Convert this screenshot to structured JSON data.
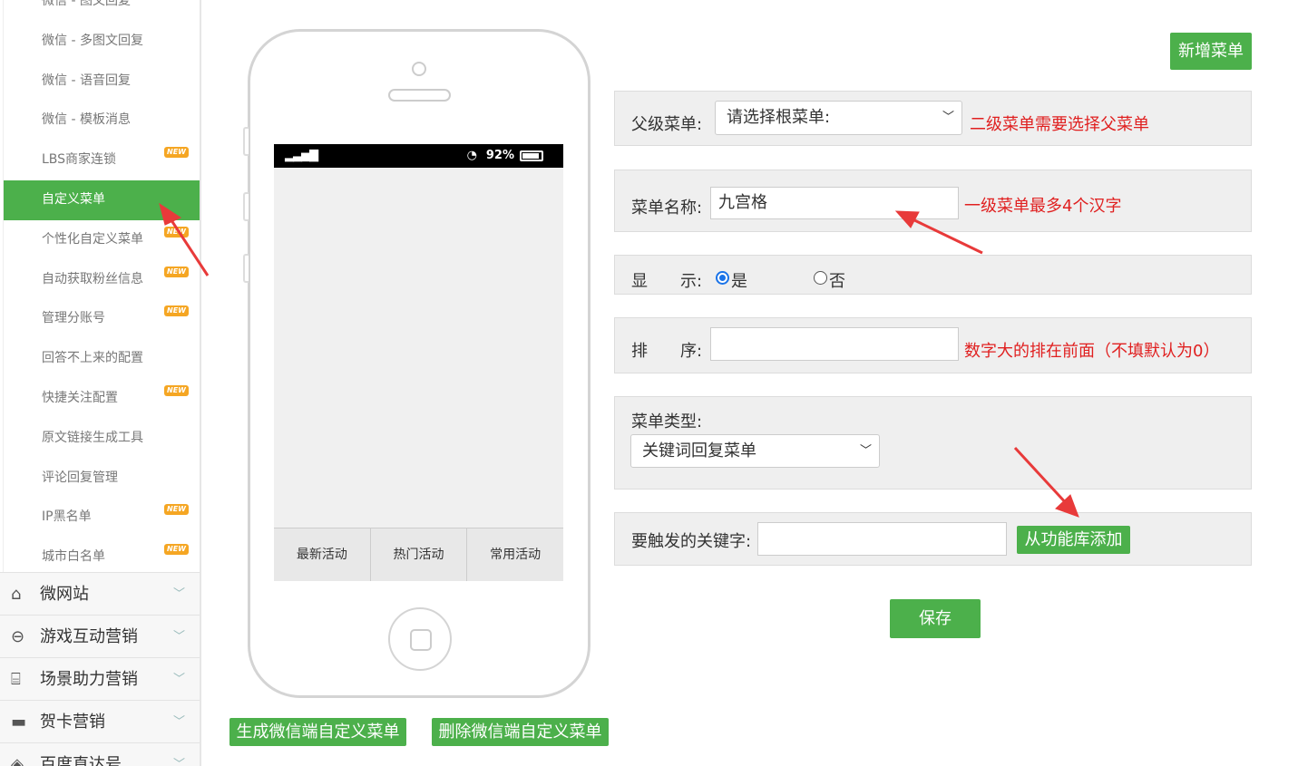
{
  "sidebar": {
    "sub_items": [
      {
        "label": "微信 - 图文回复",
        "badge": ""
      },
      {
        "label": "微信 - 多图文回复",
        "badge": ""
      },
      {
        "label": "微信 - 语音回复",
        "badge": ""
      },
      {
        "label": "微信 - 模板消息",
        "badge": ""
      },
      {
        "label": "LBS商家连锁",
        "badge": "NEW"
      },
      {
        "label": "自定义菜单",
        "badge": "",
        "active": true
      },
      {
        "label": "个性化自定义菜单",
        "badge": "NEW"
      },
      {
        "label": "自动获取粉丝信息",
        "badge": "NEW"
      },
      {
        "label": "管理分账号",
        "badge": "NEW"
      },
      {
        "label": "回答不上来的配置",
        "badge": ""
      },
      {
        "label": "快捷关注配置",
        "badge": "NEW"
      },
      {
        "label": "原文链接生成工具",
        "badge": ""
      },
      {
        "label": "评论回复管理",
        "badge": ""
      },
      {
        "label": "IP黑名单",
        "badge": "NEW"
      },
      {
        "label": "城市白名单",
        "badge": "NEW"
      }
    ],
    "main_items": [
      {
        "label": "微网站",
        "icon": "home-icon"
      },
      {
        "label": "游戏互动营销",
        "icon": "gamepad-icon"
      },
      {
        "label": "场景助力营销",
        "icon": "bank-icon"
      },
      {
        "label": "贺卡营销",
        "icon": "card-icon"
      },
      {
        "label": "百度直达号",
        "icon": "baidu-icon"
      }
    ]
  },
  "phone": {
    "signal": "▂▃▅▇",
    "clock": "◔",
    "battery": "92%",
    "menu": [
      "最新活动",
      "热门活动",
      "常用活动"
    ]
  },
  "actions": {
    "add_menu": "新增菜单",
    "generate": "生成微信端自定义菜单",
    "delete": "删除微信端自定义菜单",
    "save": "保存"
  },
  "form": {
    "parent_label": "父级菜单:",
    "parent_value": "请选择根菜单:",
    "parent_hint": "二级菜单需要选择父菜单",
    "name_label": "菜单名称:",
    "name_value": "九宫格",
    "name_hint": "一级菜单最多4个汉字",
    "display_label": "显　　示:",
    "display_yes": "是",
    "display_no": "否",
    "display_value": "是",
    "order_label": "排　　序:",
    "order_value": "",
    "order_hint": "数字大的排在前面（不填默认为0）",
    "type_label": "菜单类型:",
    "type_value": "关键词回复菜单",
    "keyword_label": "要触发的关键字:",
    "keyword_value": "",
    "keyword_button": "从功能库添加"
  },
  "colors": {
    "accent": "#4cb04b",
    "hint": "#e02020",
    "annotation_arrow": "#e83a3a"
  }
}
